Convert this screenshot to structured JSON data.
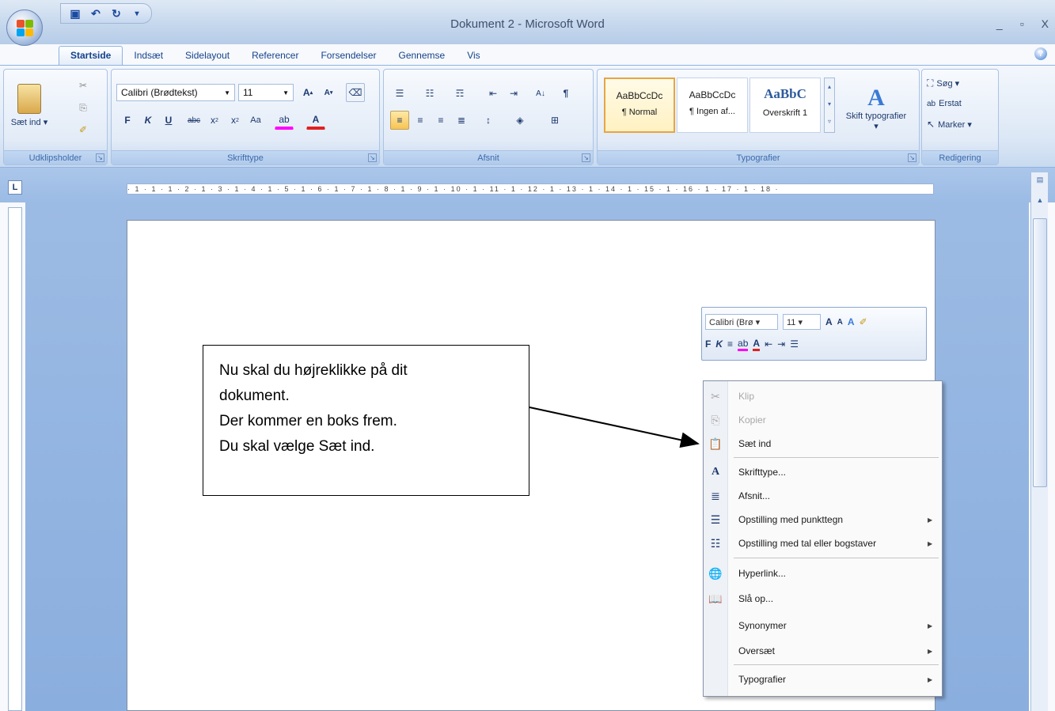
{
  "window": {
    "title": "Dokument 2 - Microsoft Word",
    "controls": [
      "_",
      "▫",
      "X"
    ]
  },
  "quick_access": {
    "icons": [
      "save-icon",
      "undo-icon",
      "redo-icon",
      "customize-icon"
    ]
  },
  "tabs": [
    "Startside",
    "Indsæt",
    "Sidelayout",
    "Referencer",
    "Forsendelser",
    "Gennemse",
    "Vis"
  ],
  "ribbon": {
    "clipboard": {
      "label": "Udklipsholder",
      "paste_label": "Sæt ind ▾"
    },
    "font": {
      "label": "Skrifttype",
      "font_name": "Calibri (Brødtekst)",
      "font_size": "11"
    },
    "paragraph": {
      "label": "Afsnit"
    },
    "styles": {
      "label": "Typografier",
      "items": [
        {
          "sample": "AaBbCcDc",
          "name": "¶ Normal"
        },
        {
          "sample": "AaBbCcDc",
          "name": "¶ Ingen af..."
        },
        {
          "sample": "AaBbC",
          "name": "Overskrift 1"
        }
      ],
      "change_label": "Skift typografier ▾"
    },
    "editing": {
      "label": "Redigering",
      "find": "Søg ▾",
      "replace": "Erstat",
      "select": "Marker ▾"
    }
  },
  "ruler_text": "· 1 · 1 · 1 · 2 · 1 · 3 · 1 · 4 · 1 · 5 · 1 · 6 · 1 · 7 · 1 · 8 · 1 · 9 · 1 · 10 · 1 · 11 · 1 · 12 · 1 · 13 · 1 · 14 · 1 · 15 · 1 · 16 · 1 · 17 · 1 · 18 ·",
  "callout": {
    "line1": "Nu skal du højreklikke på dit",
    "line2": "dokument.",
    "line3": "Der kommer en boks frem.",
    "line4": "Du skal vælge Sæt ind."
  },
  "mini_toolbar": {
    "font": "Calibri (Brø ▾",
    "size": "11 ▾"
  },
  "context_menu": [
    {
      "label": "Klip",
      "icon": "scissors-icon",
      "disabled": true,
      "submenu": false
    },
    {
      "label": "Kopier",
      "icon": "copy-icon",
      "disabled": true,
      "submenu": false
    },
    {
      "label": "Sæt ind",
      "icon": "paste-icon",
      "disabled": false,
      "submenu": false
    },
    {
      "label": "Skrifttype...",
      "icon": "font-icon",
      "disabled": false,
      "submenu": false
    },
    {
      "label": "Afsnit...",
      "icon": "paragraph-icon",
      "disabled": false,
      "submenu": false
    },
    {
      "label": "Opstilling med punkttegn",
      "icon": "bullets-icon",
      "disabled": false,
      "submenu": true
    },
    {
      "label": "Opstilling med tal eller bogstaver",
      "icon": "numbering-icon",
      "disabled": false,
      "submenu": true
    },
    {
      "label": "Hyperlink...",
      "icon": "hyperlink-icon",
      "disabled": false,
      "submenu": false
    },
    {
      "label": "Slå op...",
      "icon": "research-icon",
      "disabled": false,
      "submenu": false
    },
    {
      "label": "Synonymer",
      "icon": "",
      "disabled": false,
      "submenu": true
    },
    {
      "label": "Oversæt",
      "icon": "",
      "disabled": false,
      "submenu": true
    },
    {
      "label": "Typografier",
      "icon": "",
      "disabled": false,
      "submenu": true
    }
  ]
}
